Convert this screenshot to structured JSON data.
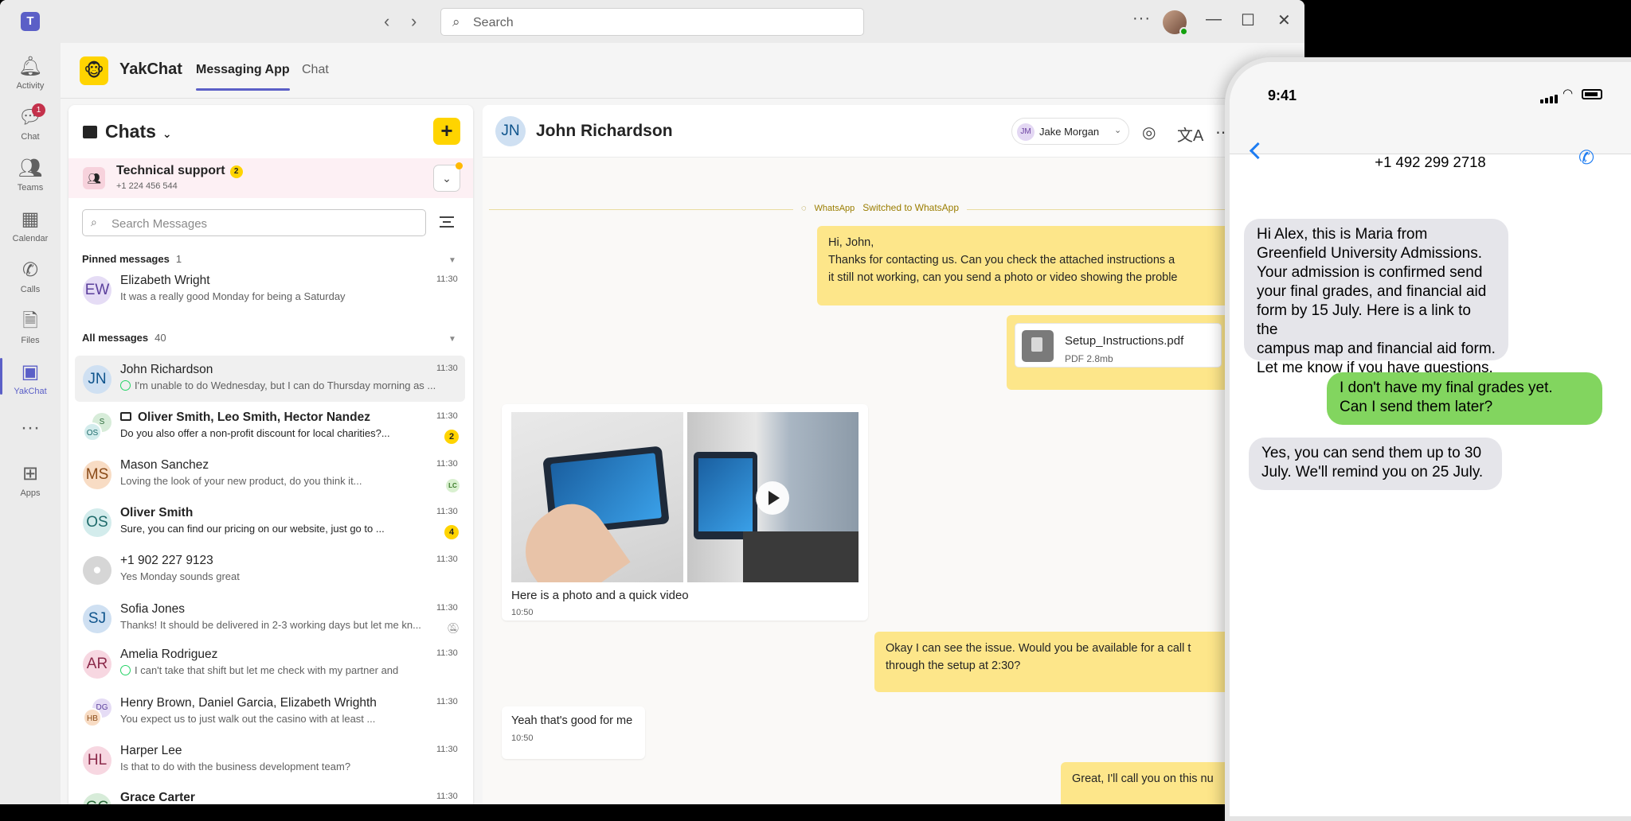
{
  "titlebar": {
    "search_placeholder": "Search",
    "back": "‹",
    "forward": "›",
    "more": "···",
    "minimize": "—",
    "maximize": "☐",
    "close": "✕"
  },
  "rail": {
    "activity": "Activity",
    "chat": "Chat",
    "chat_badge": "1",
    "teams": "Teams",
    "calendar": "Calendar",
    "calls": "Calls",
    "files": "Files",
    "yakchat": "YakChat",
    "more": "···",
    "apps": "Apps"
  },
  "app": {
    "name": "YakChat",
    "tabs": [
      "Messaging App",
      "Chat"
    ]
  },
  "chats": {
    "title": "Chats",
    "add": "+",
    "technical": {
      "name": "Technical support",
      "badge": "2",
      "phone": "+1 224 456 544"
    },
    "search_placeholder": "Search Messages",
    "pinned_label": "Pinned messages",
    "pinned_count": "1",
    "all_label": "All messages",
    "all_count": "40",
    "pinned": [
      {
        "initials": "EW",
        "name": "Elizabeth Wright",
        "preview": "It was a really good Monday for being a Saturday",
        "time": "11:30"
      }
    ],
    "items": [
      {
        "initials": "JN",
        "name": "John Richardson",
        "preview": "I'm unable to do Wednesday, but I can do Thursday morning as ...",
        "time": "11:30"
      },
      {
        "initials1": "S",
        "initials2": "OS",
        "name": "Oliver Smith, Leo Smith, Hector Nandez",
        "preview": "Do you also offer a non-profit discount for local charities?...",
        "time": "11:30",
        "badge": "2"
      },
      {
        "initials": "MS",
        "name": "Mason Sanchez",
        "preview": "Loving the look of your new product, do you think it...",
        "time": "11:30",
        "badge": "LC"
      },
      {
        "initials": "OS",
        "name": "Oliver Smith",
        "preview": "Sure, you can find our pricing on our website, just go to ...",
        "time": "11:30",
        "badge": "4"
      },
      {
        "name": "+1 902 227 9123",
        "preview": "Yes Monday sounds great",
        "time": "11:30"
      },
      {
        "initials": "SJ",
        "name": "Sofia Jones",
        "preview": "Thanks! It should be delivered in 2-3 working days but let me kn...",
        "time": "11:30"
      },
      {
        "initials": "AR",
        "name": "Amelia Rodriguez",
        "preview": "I can't take that shift but let me check with my partner and",
        "time": "11:30"
      },
      {
        "initials1": "DG",
        "initials2": "HB",
        "name": "Henry Brown, Daniel Garcia, Elizabeth Wrighth",
        "preview": "You expect us to just walk out the casino with at least ...",
        "time": "11:30"
      },
      {
        "initials": "HL",
        "name": "Harper Lee",
        "preview": "Is that to do with the business development team?",
        "time": "11:30"
      },
      {
        "initials": "GC",
        "name": "Grace Carter",
        "preview": "",
        "time": "11:30"
      }
    ]
  },
  "conversation": {
    "initials": "JN",
    "name": "John Richardson",
    "agent": {
      "initials": "JM",
      "name": "Jake Morgan"
    },
    "switch": {
      "tag": "WhatsApp",
      "text": "Switched to WhatsApp"
    },
    "msg1": {
      "line1": "Hi, John,",
      "line2": "Thanks for contacting us.  Can you check the attached instructions a",
      "line3": "it still not working, can you send a photo or video showing the proble"
    },
    "file": {
      "name": "Setup_Instructions.pdf",
      "size": "PDF 2.8mb"
    },
    "media": {
      "caption": "Here is a photo and a quick video",
      "time": "10:50"
    },
    "msg2": {
      "line1": "Okay I can see the issue. Would you be available for a call t",
      "line2": "through the setup at 2:30?"
    },
    "msg3": {
      "text": "Yeah that's good for me",
      "time": "10:50"
    },
    "msg4": {
      "text": "Great, I'll call you on this nu"
    }
  },
  "phone": {
    "time": "9:41",
    "number": "+1 492 299 2718",
    "messages": [
      {
        "dir": "in",
        "lines": [
          "Hi Alex, this is Maria from",
          "Greenfield University Admissions.",
          "Your admission is confirmed send",
          "your final grades, and financial aid",
          "form by 15 July. Here is a link to the",
          "campus map and financial aid form.",
          "Let me know if you have questions."
        ]
      },
      {
        "dir": "out",
        "lines": [
          "I don't have my final grades yet.",
          "Can I send them later?"
        ]
      },
      {
        "dir": "in",
        "lines": [
          "Yes, you can send them up to 30",
          "July. We'll remind you on 25 July."
        ]
      }
    ]
  },
  "colors": {
    "accent": "#5b5fc7",
    "yellow": "#ffd400",
    "bubble_out": "#fde68a",
    "imessage_green": "#82d55f",
    "imessage_gray": "#e5e5ea"
  }
}
